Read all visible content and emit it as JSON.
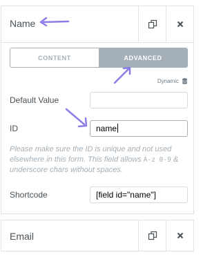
{
  "field1": {
    "title": "Name",
    "duplicate_icon": "duplicate-icon",
    "remove_icon": "close-icon"
  },
  "tabs": [
    {
      "label": "CONTENT",
      "active": false
    },
    {
      "label": "ADVANCED",
      "active": true
    }
  ],
  "dynamic_label": "Dynamic",
  "default_value": {
    "label": "Default Value",
    "value": ""
  },
  "id_field": {
    "label": "ID",
    "value": "name"
  },
  "description": {
    "part1": "Please make sure the ID is unique and not used elsewhere in this form. This field allows ",
    "code": "A-z 0-9",
    "part2": " & underscore chars without spaces."
  },
  "shortcode": {
    "label": "Shortcode",
    "value": "[field id=\"name\"]"
  },
  "field2": {
    "title": "Email",
    "duplicate_icon": "duplicate-icon",
    "remove_icon": "close-icon"
  },
  "colors": {
    "accent": "#a4afb7",
    "annotation_arrow": "#8c7ce8"
  }
}
